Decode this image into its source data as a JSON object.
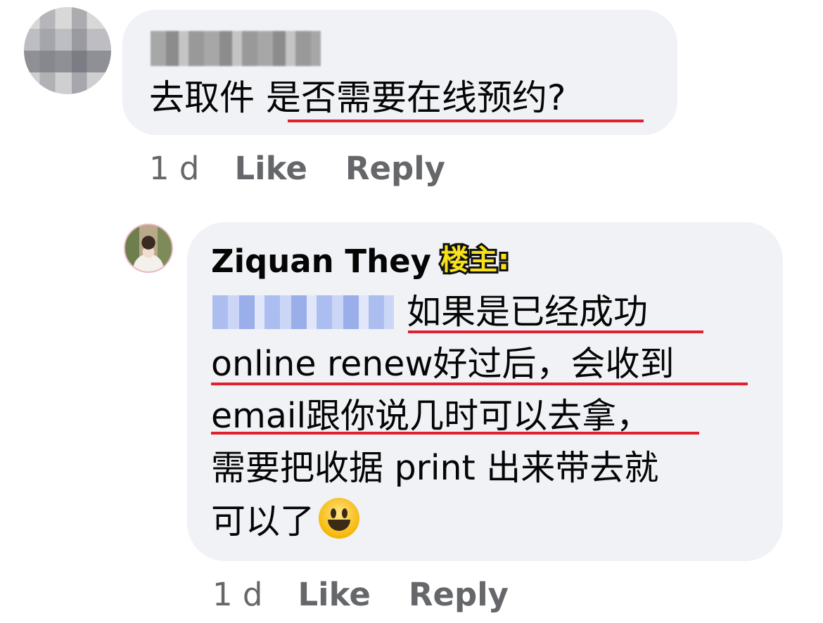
{
  "comments": [
    {
      "author": "",
      "text": "去取件 是否需要在线预约?",
      "time": "1 d",
      "like_label": "Like",
      "reply_label": "Reply"
    },
    {
      "author": "Ziquan They",
      "badge": "楼主:",
      "lines": [
        "如果是已经成功",
        "online renew好过后，会收到",
        "email跟你说几时可以去拿，",
        "需要把收据 print 出来带去就",
        "可以了"
      ],
      "emoji": "grinning-face",
      "time": "1 d",
      "like_label": "Like",
      "reply_label": "Reply"
    }
  ],
  "colors": {
    "bubble": "#f0f2f5",
    "meta_text": "#65676b",
    "underline": "#e0202e",
    "badge_fill": "#f7e11a"
  }
}
